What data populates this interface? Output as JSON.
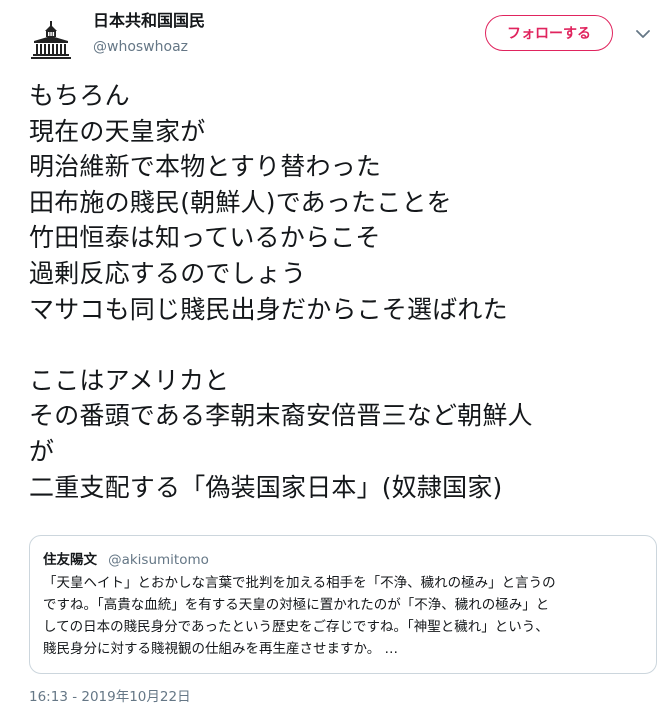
{
  "tweet": {
    "author": {
      "display_name": "日本共和国国民",
      "handle": "@whoswhoaz",
      "avatar_icon": "parliament-building-icon"
    },
    "follow_label": "フォローする",
    "menu_icon": "chevron-down-icon",
    "text": "もちろん\n現在の天皇家が\n明治維新で本物とすり替わった\n田布施の賤民(朝鮮人)であったことを\n竹田恒泰は知っているからこそ\n過剰反応するのでしょう\nマサコも同じ賤民出身だからこそ選ばれた\n\nここはアメリカと\nその番頭である李朝末裔安倍晋三など朝鮮人\nが\n二重支配する「偽装国家日本」(奴隷国家)",
    "quoted": {
      "display_name": "住友陽文",
      "handle": "@akisumitomo",
      "text": "「天皇ヘイト」とおかしな言葉で批判を加える相手を「不浄、穢れの極み」と言うの\nですね。「高貴な血統」を有する天皇の対極に置かれたのが「不浄、穢れの極み」と\nしての日本の賤民身分であったという歴史をご存じですね。「神聖と穢れ」という、\n賤民身分に対する賤視観の仕組みを再生産させますか。 …"
    },
    "timestamp": "16:13 - 2019年10月22日"
  },
  "colors": {
    "follow_accent": "#e0245e",
    "secondary_text": "#657786",
    "primary_text": "#14171a",
    "border": "#ccd6dd"
  }
}
